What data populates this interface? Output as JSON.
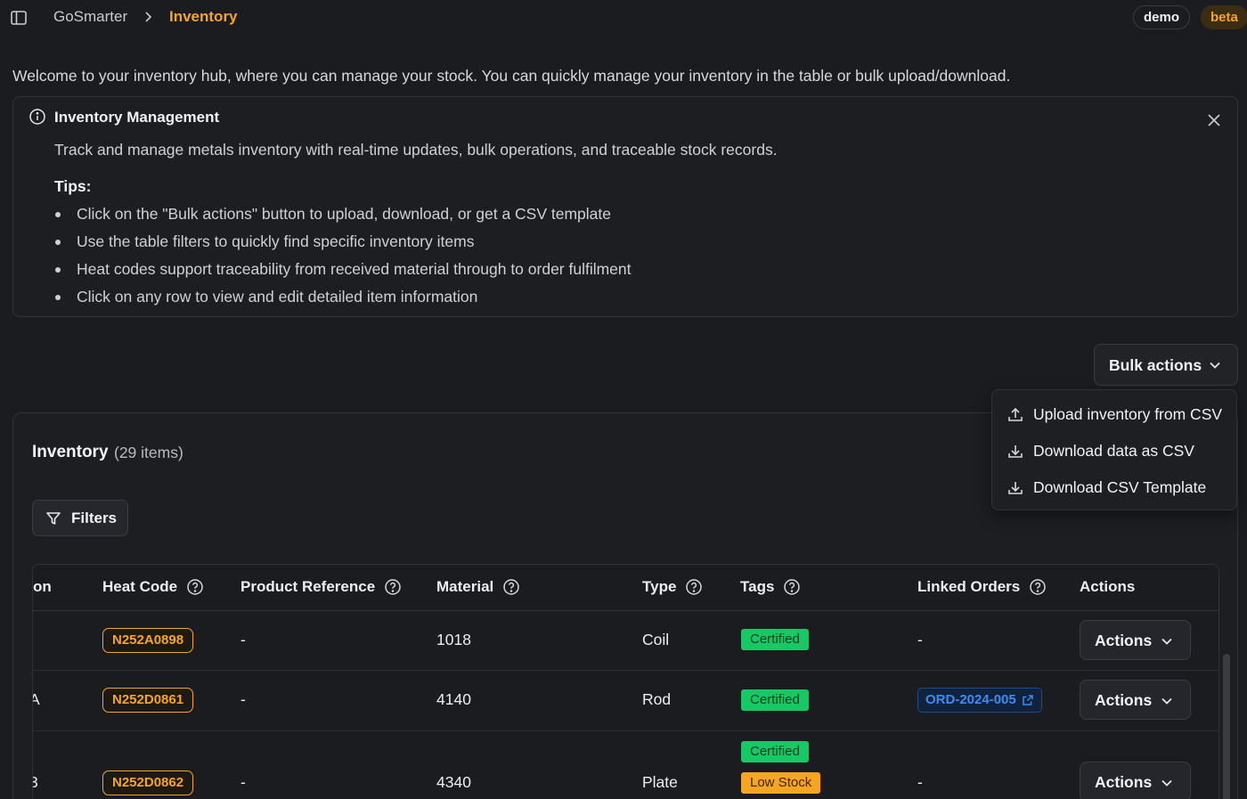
{
  "breadcrumb": {
    "root": "GoSmarter",
    "current": "Inventory"
  },
  "badges": {
    "demo": "demo",
    "beta": "beta"
  },
  "welcome": "Welcome to your inventory hub, where you can manage your stock. You can quickly manage your inventory in the table or bulk upload/download.",
  "info": {
    "title": "Inventory Management",
    "description": "Track and manage metals inventory with real-time updates, bulk operations, and traceable stock records.",
    "tips_title": "Tips:",
    "tips": [
      "Click on the \"Bulk actions\" button to upload, download, or get a CSV template",
      "Use the table filters to quickly find specific inventory items",
      "Heat codes support traceability from received material through to order fulfilment",
      "Click on any row to view and edit detailed item information"
    ]
  },
  "bulk": {
    "label": "Bulk actions",
    "menu": [
      {
        "label": "Upload inventory from CSV",
        "icon": "upload-icon"
      },
      {
        "label": "Download data as CSV",
        "icon": "download-icon"
      },
      {
        "label": "Download CSV Template",
        "icon": "download-icon"
      }
    ]
  },
  "inventory": {
    "title": "Inventory",
    "count": "(29 items)",
    "filters_label": "Filters",
    "columns": {
      "location_partial": "on",
      "heat_code": "Heat Code",
      "product_reference": "Product Reference",
      "material": "Material",
      "type": "Type",
      "tags": "Tags",
      "linked_orders": "Linked Orders",
      "actions": "Actions"
    },
    "rows": [
      {
        "location_partial": "",
        "heat_code": "N252A0898",
        "product_reference": "-",
        "material": "1018",
        "type": "Coil",
        "tags": [
          "Certified"
        ],
        "linked_order": "-",
        "action_label": "Actions"
      },
      {
        "location_partial": "A",
        "heat_code": "N252D0861",
        "product_reference": "-",
        "material": "4140",
        "type": "Rod",
        "tags": [
          "Certified"
        ],
        "linked_order": "ORD-2024-005",
        "action_label": "Actions"
      },
      {
        "location_partial": "3",
        "heat_code": "N252D0862",
        "product_reference": "-",
        "material": "4340",
        "type": "Plate",
        "tags": [
          "Certified",
          "Low Stock"
        ],
        "linked_order": "-",
        "action_label": "Actions"
      }
    ]
  },
  "colors": {
    "background": "#1b1c20",
    "accent": "#f5a524",
    "certified": "#17c964",
    "low_stock": "#f5a524",
    "link": "#3b8cf5"
  }
}
